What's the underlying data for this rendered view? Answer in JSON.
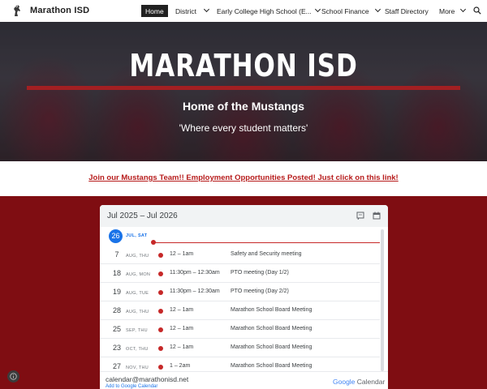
{
  "nav": {
    "site_title": "Marathon ISD",
    "items": [
      {
        "label": "Home"
      },
      {
        "label": "District"
      },
      {
        "label": "Early College High School (E..."
      },
      {
        "label": "School Finance"
      },
      {
        "label": "Staff Directory"
      },
      {
        "label": "More"
      }
    ]
  },
  "hero": {
    "title": "MARATHON ISD",
    "subtitle": "Home of the Mustangs",
    "quote": "'Where every student matters'"
  },
  "banner": {
    "link_text": "Join our Mustangs Team!!  Employment Opportunities Posted! Just click on this link!"
  },
  "calendar": {
    "range": "Jul 2025 – Jul 2026",
    "today": {
      "day": "26",
      "label": "JUL, SAT"
    },
    "events": [
      {
        "day": "7",
        "weekday": "AUG, THU",
        "time": "12 – 1am",
        "title": "Safety and Security meeting"
      },
      {
        "day": "18",
        "weekday": "AUG, MON",
        "time": "11:30pm – 12:30am",
        "title": "PTO meeting (Day 1/2)"
      },
      {
        "day": "19",
        "weekday": "AUG, TUE",
        "time": "11:30pm – 12:30am",
        "title": "PTO meeting (Day 2/2)"
      },
      {
        "day": "28",
        "weekday": "AUG, THU",
        "time": "12 – 1am",
        "title": "Marathon School Board Meeting"
      },
      {
        "day": "25",
        "weekday": "SEP, THU",
        "time": "12 – 1am",
        "title": "Marathon School Board Meeting"
      },
      {
        "day": "23",
        "weekday": "OCT, THU",
        "time": "12 – 1am",
        "title": "Marathon School Board Meeting"
      },
      {
        "day": "27",
        "weekday": "NOV, THU",
        "time": "1 – 2am",
        "title": "Marathon School Board Meeting"
      }
    ],
    "footer_email": "calendar@marathonisd.net",
    "add_link": "Add to Google Calendar",
    "logo_google": "Google",
    "logo_calendar": "Calendar"
  },
  "colors": {
    "accent_maroon": "#7f0d12",
    "hero_bar": "#a31f22",
    "link_red": "#b71c1c",
    "event_dot": "#c62828",
    "today_blue": "#1a73e8"
  }
}
